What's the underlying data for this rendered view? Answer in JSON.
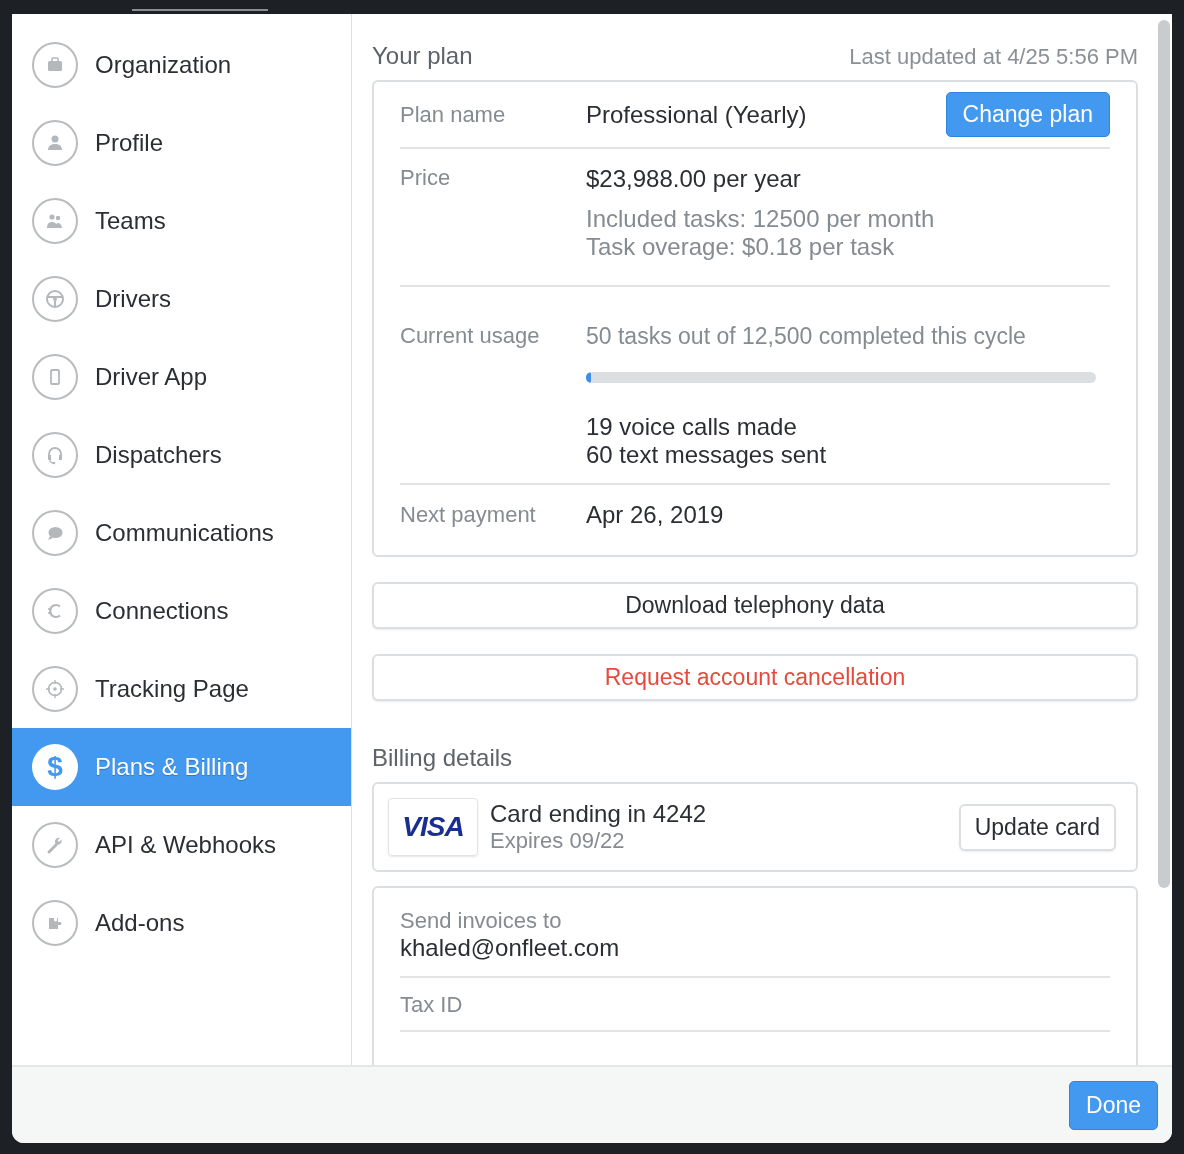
{
  "sidebar": {
    "items": [
      {
        "label": "Organization",
        "selected": false
      },
      {
        "label": "Profile",
        "selected": false
      },
      {
        "label": "Teams",
        "selected": false
      },
      {
        "label": "Drivers",
        "selected": false
      },
      {
        "label": "Driver App",
        "selected": false
      },
      {
        "label": "Dispatchers",
        "selected": false
      },
      {
        "label": "Communications",
        "selected": false
      },
      {
        "label": "Connections",
        "selected": false
      },
      {
        "label": "Tracking Page",
        "selected": false
      },
      {
        "label": "Plans & Billing",
        "selected": true,
        "icon_text": "$"
      },
      {
        "label": "API & Webhooks",
        "selected": false
      },
      {
        "label": "Add-ons",
        "selected": false
      }
    ]
  },
  "plan": {
    "title": "Your plan",
    "updated": "Last updated at 4/25 5:56 PM",
    "plan_name": {
      "label": "Plan name",
      "value": "Professional (Yearly)",
      "button": "Change plan"
    },
    "price": {
      "label": "Price",
      "value": "$23,988.00 per year",
      "details": [
        "Included tasks: 12500 per month",
        "Task overage: $0.18 per task"
      ]
    },
    "usage": {
      "label": "Current usage",
      "summary": "50 tasks out of 12,500 completed this cycle",
      "level": 0.01,
      "details": [
        "19 voice calls made",
        "60 text messages sent"
      ]
    },
    "next_payment": {
      "label": "Next payment",
      "value": "Apr 26, 2019"
    }
  },
  "actions": [
    {
      "label": "Download telephony data",
      "kind": "default"
    },
    {
      "label": "Request account cancellation",
      "kind": "danger"
    }
  ],
  "billing": {
    "title": "Billing details",
    "card": {
      "brand": "VISA",
      "title": "Card ending in 4242",
      "expires": "Expires 09/22",
      "button": "Update card"
    },
    "invoices": {
      "label": "Send invoices to",
      "value": "khaled@onfleet.com"
    },
    "tax_id": {
      "label": "Tax ID"
    }
  },
  "footer": {
    "button": "Done"
  }
}
